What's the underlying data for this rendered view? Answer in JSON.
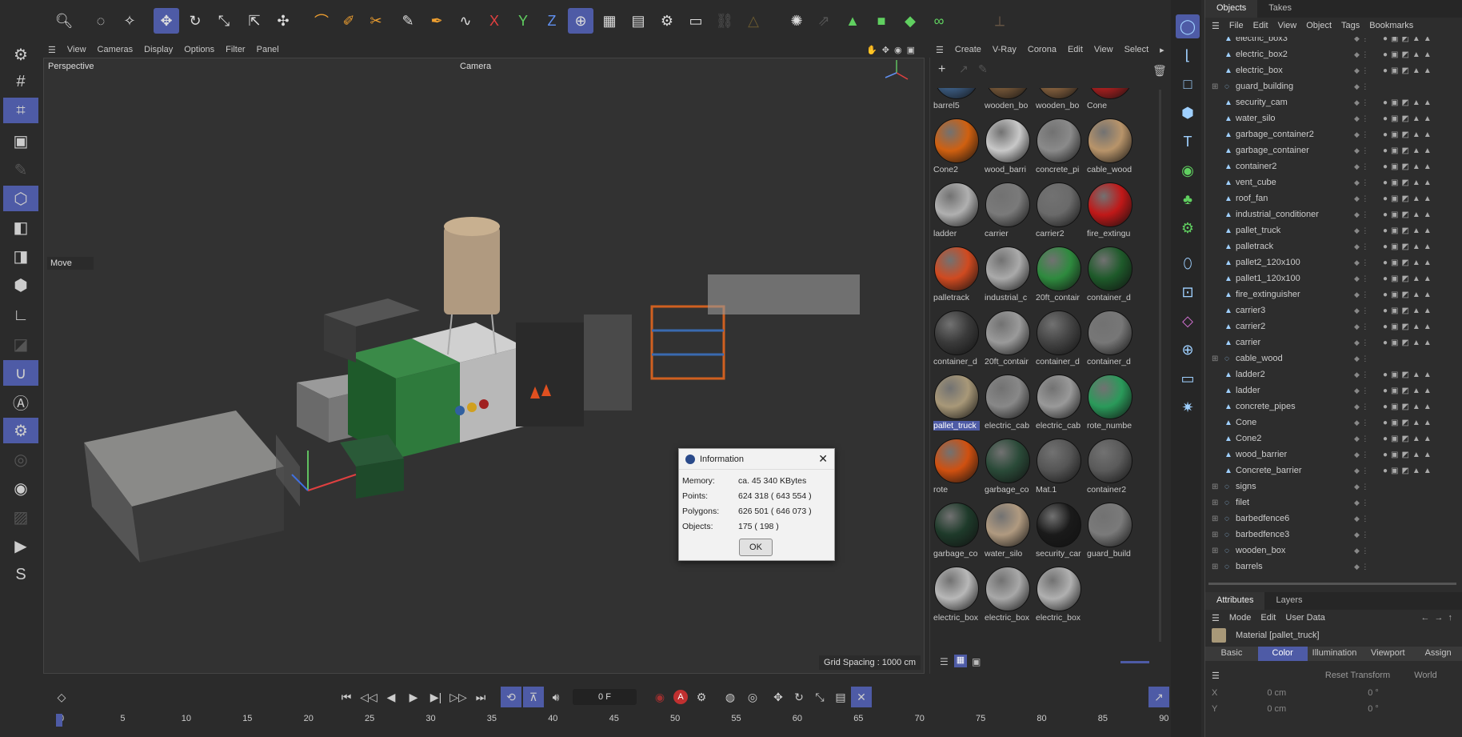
{
  "viewport_menu": [
    "View",
    "Cameras",
    "Display",
    "Options",
    "Filter",
    "Panel"
  ],
  "viewport": {
    "perspective": "Perspective",
    "camera": "Camera",
    "move": "Move",
    "grid": "Grid Spacing : 1000 cm"
  },
  "material_menu": [
    "Create",
    "V-Ray",
    "Corona",
    "Edit",
    "View",
    "Select"
  ],
  "materials": [
    {
      "name": "barrel5",
      "color": "#3e6088"
    },
    {
      "name": "wooden_bo",
      "color": "#7a5a3a"
    },
    {
      "name": "wooden_bo",
      "color": "#8a6440"
    },
    {
      "name": "Cone",
      "color": "#b02020"
    },
    {
      "name": "Cone2",
      "color": "#d06010"
    },
    {
      "name": "wood_barri",
      "color": "#c8c8c8"
    },
    {
      "name": "concrete_pi",
      "color": "#8a8a8a"
    },
    {
      "name": "cable_wood",
      "color": "#b8946a"
    },
    {
      "name": "ladder",
      "color": "#b0b0b0"
    },
    {
      "name": "carrier",
      "color": "#7a7a7a"
    },
    {
      "name": "carrier2",
      "color": "#6a6a6a"
    },
    {
      "name": "fire_extingu",
      "color": "#c01818"
    },
    {
      "name": "palletrack",
      "color": "#d04a20"
    },
    {
      "name": "industrial_c",
      "color": "#aaaaaa"
    },
    {
      "name": "20ft_contair",
      "color": "#2e8a3e"
    },
    {
      "name": "container_d",
      "color": "#1e5a2a"
    },
    {
      "name": "container_d",
      "color": "#3a3a3a"
    },
    {
      "name": "20ft_contair",
      "color": "#9a9a9a"
    },
    {
      "name": "container_d",
      "color": "#444444"
    },
    {
      "name": "container_d",
      "color": "#777777"
    },
    {
      "name": "pallet_truck",
      "color": "#a89878"
    },
    {
      "name": "electric_cab",
      "color": "#888888"
    },
    {
      "name": "electric_cab",
      "color": "#999999"
    },
    {
      "name": "rote_numbe",
      "color": "#2a9a5a"
    },
    {
      "name": "rote",
      "color": "#d05010"
    },
    {
      "name": "garbage_co",
      "color": "#2a4a38"
    },
    {
      "name": "Mat.1",
      "color": "#555555"
    },
    {
      "name": "container2",
      "color": "#5a5a5a"
    },
    {
      "name": "garbage_co",
      "color": "#1e3a2a"
    },
    {
      "name": "water_silo",
      "color": "#b09a80"
    },
    {
      "name": "security_car",
      "color": "#1a1a1a"
    },
    {
      "name": "guard_build",
      "color": "#7a7a7a"
    },
    {
      "name": "electric_box",
      "color": "#b8b8b8"
    },
    {
      "name": "electric_box",
      "color": "#a8a8a8"
    },
    {
      "name": "electric_box",
      "color": "#b0b0b0"
    }
  ],
  "selected_material_index": 20,
  "objects_tabs": [
    "Objects",
    "Takes"
  ],
  "objects_menu": [
    "File",
    "Edit",
    "View",
    "Object",
    "Tags",
    "Bookmarks"
  ],
  "objects": [
    {
      "name": "electric_box3",
      "group": false
    },
    {
      "name": "electric_box2",
      "group": false
    },
    {
      "name": "electric_box",
      "group": false
    },
    {
      "name": "guard_building",
      "group": true
    },
    {
      "name": "security_cam",
      "group": false
    },
    {
      "name": "water_silo",
      "group": false
    },
    {
      "name": "garbage_container2",
      "group": false
    },
    {
      "name": "garbage_container",
      "group": false
    },
    {
      "name": "container2",
      "group": false
    },
    {
      "name": "vent_cube",
      "group": false
    },
    {
      "name": "roof_fan",
      "group": false
    },
    {
      "name": "industrial_conditioner",
      "group": false
    },
    {
      "name": "pallet_truck",
      "group": false
    },
    {
      "name": "palletrack",
      "group": false
    },
    {
      "name": "pallet2_120x100",
      "group": false
    },
    {
      "name": "pallet1_120x100",
      "group": false
    },
    {
      "name": "fire_extinguisher",
      "group": false
    },
    {
      "name": "carrier3",
      "group": false
    },
    {
      "name": "carrier2",
      "group": false
    },
    {
      "name": "carrier",
      "group": false
    },
    {
      "name": "cable_wood",
      "group": true
    },
    {
      "name": "ladder2",
      "group": false
    },
    {
      "name": "ladder",
      "group": false
    },
    {
      "name": "concrete_pipes",
      "group": false
    },
    {
      "name": "Cone",
      "group": false
    },
    {
      "name": "Cone2",
      "group": false
    },
    {
      "name": "wood_barrier",
      "group": false
    },
    {
      "name": "Concrete_barrier",
      "group": false
    },
    {
      "name": "signs",
      "group": true
    },
    {
      "name": "filet",
      "group": true
    },
    {
      "name": "barbedfence6",
      "group": true
    },
    {
      "name": "barbedfence3",
      "group": true
    },
    {
      "name": "wooden_box",
      "group": true
    },
    {
      "name": "barrels",
      "group": true
    }
  ],
  "attr_tabs": [
    "Attributes",
    "Layers"
  ],
  "attr_menu": [
    "Mode",
    "Edit",
    "User Data"
  ],
  "attr_title": "Material [pallet_truck]",
  "attr_subtabs": [
    "Basic",
    "Color",
    "Illumination",
    "Viewport",
    "Assign"
  ],
  "attr_reset": "Reset Transform",
  "attr_world": "World",
  "attr_x": "X",
  "attr_y": "Y",
  "attr_val_cm": "0 cm",
  "attr_val_deg": "0 °",
  "timeline": {
    "frame": "0 F",
    "ticks": [
      "0",
      "5",
      "10",
      "15",
      "20",
      "25",
      "30",
      "35",
      "40",
      "45",
      "50",
      "55",
      "60",
      "65",
      "70",
      "75",
      "80",
      "85",
      "90"
    ]
  },
  "dialog": {
    "title": "Information",
    "memory_label": "Memory:",
    "memory": "ca. 45 340 KBytes",
    "points_label": "Points:",
    "points": "624 318 ( 643 554 )",
    "polygons_label": "Polygons:",
    "polygons": "626 501 ( 646 073 )",
    "objects_label": "Objects:",
    "objects": "175 ( 198 )",
    "ok": "OK"
  }
}
